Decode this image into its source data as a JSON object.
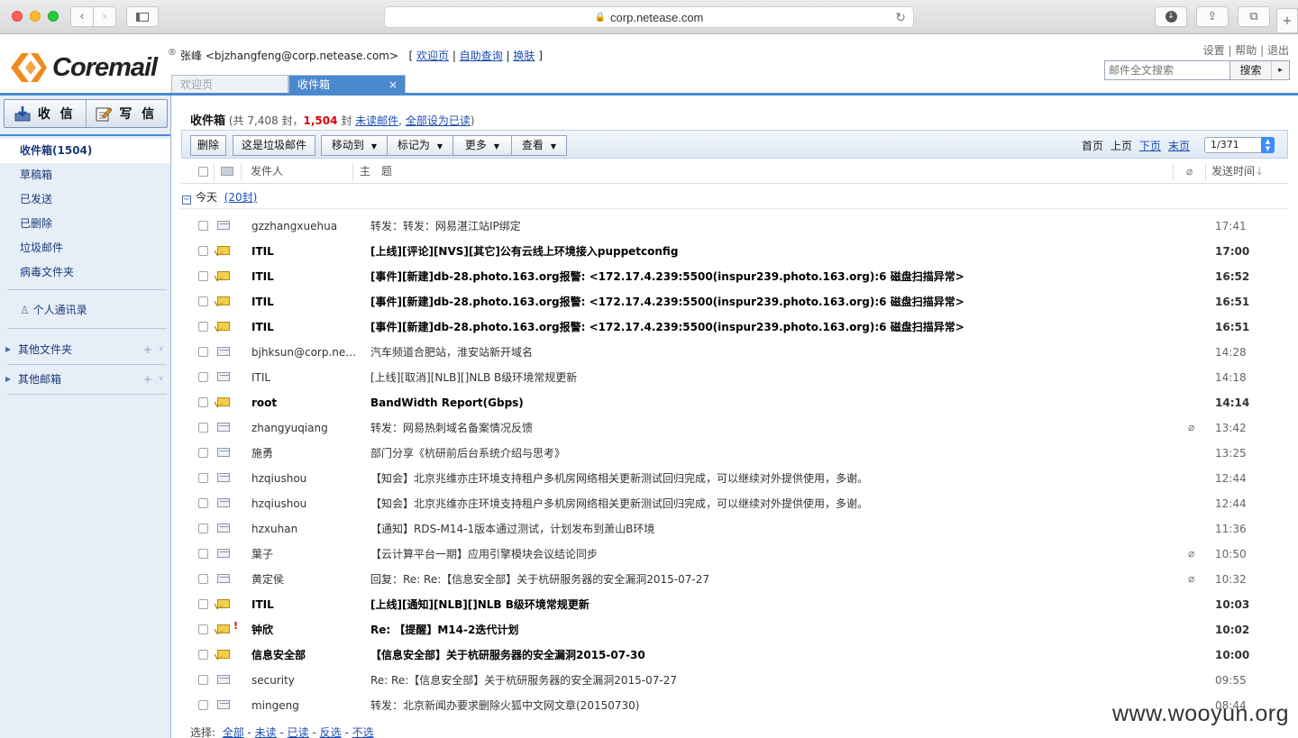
{
  "browser": {
    "url": "corp.netease.com"
  },
  "brand": {
    "logo_text": "Coremail",
    "reg_mark": "®"
  },
  "user": {
    "name": "张峰",
    "email": "<bjzhangfeng@corp.netease.com>",
    "links": [
      "欢迎页",
      "自助查询",
      "换肤"
    ]
  },
  "top_links": [
    "设置",
    "帮助",
    "退出"
  ],
  "search": {
    "placeholder": "邮件全文搜索",
    "button": "搜索",
    "arrow": "▸"
  },
  "tabs": [
    {
      "label": "欢迎页",
      "active": false
    },
    {
      "label": "收件箱",
      "active": true,
      "close": "×"
    }
  ],
  "sidebar": {
    "receive_label": "收 信",
    "compose_label": "写 信",
    "folders": [
      {
        "label": "收件箱",
        "count": "(1504)",
        "active": true
      },
      {
        "label": "草稿箱"
      },
      {
        "label": "已发送"
      },
      {
        "label": "已删除"
      },
      {
        "label": "垃圾邮件"
      },
      {
        "label": "病毒文件夹"
      }
    ],
    "contacts_label": "个人通讯录",
    "other_folders_label": "其他文件夹",
    "other_mailboxes_label": "其他邮箱",
    "add_symbol": "+",
    "menu_symbol": "ᵞ"
  },
  "main": {
    "title": "收件箱",
    "count_prefix": "(共 7,408 封，",
    "unread_count": "1,504",
    "count_suffix": "封",
    "link_unread": "未读邮件",
    "link_mark_all": "全部设为已读",
    "close_paren": ")"
  },
  "toolbar": {
    "delete": "删除",
    "spam": "这是垃圾邮件",
    "move_to": "移动到",
    "mark_as": "标记为",
    "more": "更多",
    "view": "查看",
    "dropdown": "▼"
  },
  "pager": {
    "first": "首页",
    "prev": "上页",
    "next": "下页",
    "last": "末页",
    "current": "1/371"
  },
  "columns": {
    "from": "发件人",
    "subject": "主　题",
    "time": "发送时间",
    "sort_arrow": "↓"
  },
  "group": {
    "toggle": "−",
    "label": "今天",
    "count": "(20封)"
  },
  "messages": [
    {
      "from": "gzzhangxuehua",
      "subject": "转发：转发：网易湛江站IP绑定",
      "time": "17:41",
      "unread": false,
      "attach": false,
      "flag": false
    },
    {
      "from": "ITIL",
      "subject": "[上线][评论][NVS][其它]公有云线上环境接入puppetconfig",
      "time": "17:00",
      "unread": true,
      "attach": false,
      "flag": false
    },
    {
      "from": "ITIL",
      "subject": "[事件][新建]db-28.photo.163.org报警: <172.17.4.239:5500(inspur239.photo.163.org):6 磁盘扫描异常>",
      "time": "16:52",
      "unread": true,
      "attach": false,
      "flag": false
    },
    {
      "from": "ITIL",
      "subject": "[事件][新建]db-28.photo.163.org报警: <172.17.4.239:5500(inspur239.photo.163.org):6 磁盘扫描异常>",
      "time": "16:51",
      "unread": true,
      "attach": false,
      "flag": false
    },
    {
      "from": "ITIL",
      "subject": "[事件][新建]db-28.photo.163.org报警: <172.17.4.239:5500(inspur239.photo.163.org):6 磁盘扫描异常>",
      "time": "16:51",
      "unread": true,
      "attach": false,
      "flag": false
    },
    {
      "from": "bjhksun@corp.net...",
      "subject": "汽车频道合肥站，淮安站新开域名",
      "time": "14:28",
      "unread": false,
      "attach": false,
      "flag": false
    },
    {
      "from": "ITIL",
      "subject": "[上线][取消][NLB][]NLB B级环境常规更新",
      "time": "14:18",
      "unread": false,
      "attach": false,
      "flag": false
    },
    {
      "from": "root",
      "subject": "BandWidth Report(Gbps)",
      "time": "14:14",
      "unread": true,
      "attach": false,
      "flag": false
    },
    {
      "from": "zhangyuqiang",
      "subject": "转发：网易热刺域名备案情况反馈",
      "time": "13:42",
      "unread": false,
      "attach": true,
      "flag": false
    },
    {
      "from": "施勇",
      "subject": "部门分享《杭研前后台系统介绍与思考》",
      "time": "13:25",
      "unread": false,
      "attach": false,
      "flag": false
    },
    {
      "from": "hzqiushou",
      "subject": "【知会】北京兆维亦庄环境支持租户多机房网络相关更新测试回归完成，可以继续对外提供使用，多谢。",
      "time": "12:44",
      "unread": false,
      "attach": false,
      "flag": false
    },
    {
      "from": "hzqiushou",
      "subject": "【知会】北京兆维亦庄环境支持租户多机房网络相关更新测试回归完成，可以继续对外提供使用，多谢。",
      "time": "12:44",
      "unread": false,
      "attach": false,
      "flag": false
    },
    {
      "from": "hzxuhan",
      "subject": "【通知】RDS-M14-1版本通过测试，计划发布到萧山B环境",
      "time": "11:36",
      "unread": false,
      "attach": false,
      "flag": false
    },
    {
      "from": "葉子",
      "subject": "【云计算平台一期】应用引擎模块会议结论同步",
      "time": "10:50",
      "unread": false,
      "attach": true,
      "flag": false
    },
    {
      "from": "黄定侯",
      "subject": "回复：Re: Re:【信息安全部】关于杭研服务器的安全漏洞2015-07-27",
      "time": "10:32",
      "unread": false,
      "attach": true,
      "flag": false
    },
    {
      "from": "ITIL",
      "subject": "[上线][通知][NLB][]NLB B级环境常规更新",
      "time": "10:03",
      "unread": true,
      "attach": false,
      "flag": false
    },
    {
      "from": "钟欣",
      "subject": "Re: 【提醒】M14-2迭代计划",
      "time": "10:02",
      "unread": true,
      "attach": false,
      "flag": true
    },
    {
      "from": "信息安全部",
      "subject": "【信息安全部】关于杭研服务器的安全漏洞2015-07-30",
      "time": "10:00",
      "unread": true,
      "attach": false,
      "flag": false
    },
    {
      "from": "security",
      "subject": "Re: Re:【信息安全部】关于杭研服务器的安全漏洞2015-07-27",
      "time": "09:55",
      "unread": false,
      "attach": false,
      "flag": false
    },
    {
      "from": "mingeng",
      "subject": "转发：北京新闻办要求删除火狐中文网文章(20150730)",
      "time": "08:44",
      "unread": false,
      "attach": false,
      "flag": false
    }
  ],
  "footer": {
    "label": "选择:",
    "options": [
      "全部",
      "未读",
      "已读",
      "反选",
      "不选"
    ]
  },
  "watermark": "www.wooyun.org"
}
